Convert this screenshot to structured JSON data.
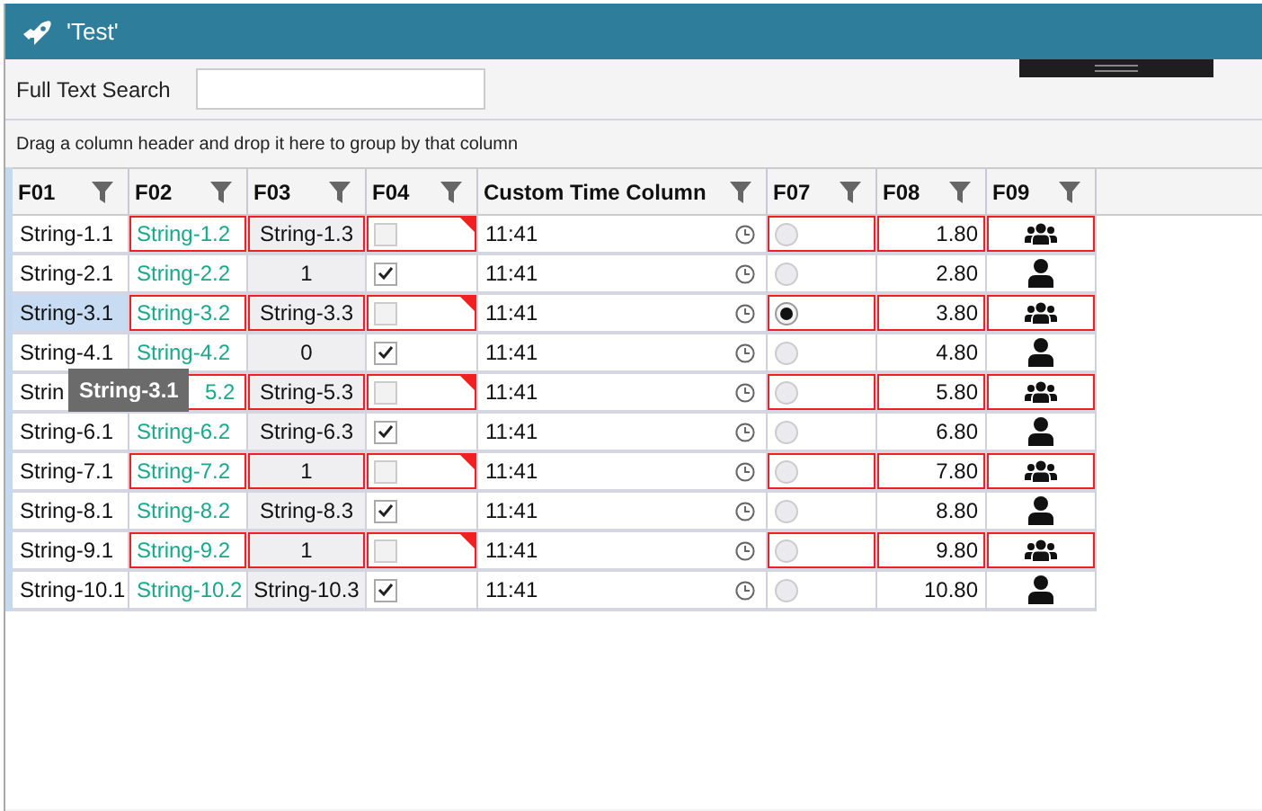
{
  "window": {
    "title": "'Test'"
  },
  "search": {
    "label": "Full Text Search"
  },
  "group_panel": {
    "text": "Drag a column header and drop it here to group by that column"
  },
  "columns": [
    {
      "label": "F01",
      "kind": "text"
    },
    {
      "label": "F02",
      "kind": "link"
    },
    {
      "label": "F03",
      "kind": "center"
    },
    {
      "label": "F04",
      "kind": "check"
    },
    {
      "label": "Custom Time Column",
      "kind": "time"
    },
    {
      "label": "F07",
      "kind": "radio"
    },
    {
      "label": "F08",
      "kind": "number"
    },
    {
      "label": "F09",
      "kind": "people"
    }
  ],
  "rows": [
    {
      "cells": [
        "String-1.1",
        "String-1.2",
        "String-1.3",
        false,
        "11:41",
        false,
        "1.80"
      ],
      "kind": "group",
      "flagged": true,
      "selected": false
    },
    {
      "cells": [
        "String-2.1",
        "String-2.2",
        "1",
        true,
        "11:41",
        false,
        "2.80"
      ],
      "kind": "person",
      "flagged": false,
      "selected": false
    },
    {
      "cells": [
        "String-3.1",
        "String-3.2",
        "String-3.3",
        false,
        "11:41",
        true,
        "3.80"
      ],
      "kind": "group",
      "flagged": true,
      "selected": true
    },
    {
      "cells": [
        "String-4.1",
        "String-4.2",
        "0",
        true,
        "11:41",
        false,
        "4.80"
      ],
      "kind": "person",
      "flagged": false,
      "selected": false
    },
    {
      "cells": [
        "Strin",
        "5.2",
        "String-5.3",
        false,
        "11:41",
        false,
        "5.80"
      ],
      "kind": "group",
      "flagged": true,
      "selected": false,
      "covered": true
    },
    {
      "cells": [
        "String-6.1",
        "String-6.2",
        "String-6.3",
        true,
        "11:41",
        false,
        "6.80"
      ],
      "kind": "person",
      "flagged": false,
      "selected": false
    },
    {
      "cells": [
        "String-7.1",
        "String-7.2",
        "1",
        false,
        "11:41",
        false,
        "7.80"
      ],
      "kind": "group",
      "flagged": true,
      "selected": false
    },
    {
      "cells": [
        "String-8.1",
        "String-8.2",
        "String-8.3",
        true,
        "11:41",
        false,
        "8.80"
      ],
      "kind": "person",
      "flagged": false,
      "selected": false
    },
    {
      "cells": [
        "String-9.1",
        "String-9.2",
        "1",
        false,
        "11:41",
        false,
        "9.80"
      ],
      "kind": "group",
      "flagged": true,
      "selected": false
    },
    {
      "cells": [
        "String-10.1",
        "String-10.2",
        "String-10.3",
        true,
        "11:41",
        false,
        "10.80"
      ],
      "kind": "person",
      "flagged": false,
      "selected": false
    }
  ],
  "tooltip": {
    "text": "String-3.1"
  }
}
